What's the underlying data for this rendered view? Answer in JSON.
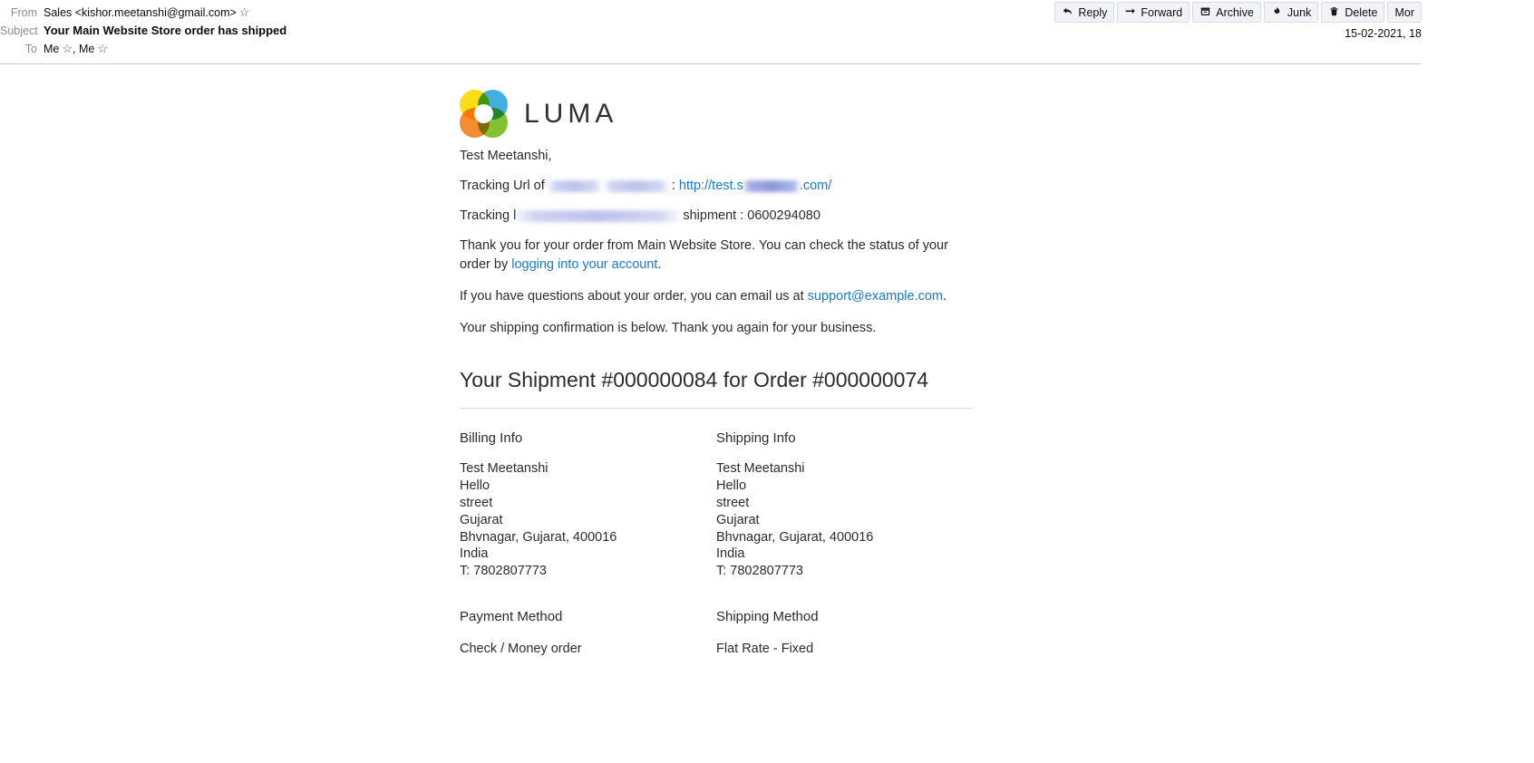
{
  "header": {
    "fields": [
      {
        "label": "From",
        "value": "Sales <kishor.meetanshi@gmail.com>",
        "starred": true
      },
      {
        "label": "Subject",
        "value": "Your Main Website Store order has shipped",
        "starred": false
      },
      {
        "label": "To",
        "value": "Me",
        "value2": "Me",
        "starred": true
      }
    ],
    "to_separator": ", ",
    "date": "15-02-2021, 18"
  },
  "toolbar": {
    "buttons": [
      {
        "label": "Reply",
        "icon": "reply-icon",
        "glyph": "↰"
      },
      {
        "label": "Forward",
        "icon": "forward-icon",
        "glyph": "→"
      },
      {
        "label": "Archive",
        "icon": "archive-icon",
        "glyph": "⤓"
      },
      {
        "label": "Junk",
        "icon": "junk-icon",
        "glyph": "ⓧ"
      },
      {
        "label": "Delete",
        "icon": "trash-icon",
        "glyph": "Ὕ1"
      },
      {
        "label": "Mor",
        "icon": "more-icon",
        "glyph": ""
      }
    ]
  },
  "email": {
    "brand": "LUMA",
    "greeting": "Test Meetanshi,",
    "tracking_url_label": "Tracking Url of",
    "tracking_url_sep": ":",
    "tracking_url_prefix": "http://test.s",
    "tracking_url_suffix": ".com/",
    "tracking_number_label": "Tracking",
    "tracking_number_label_tail": "l",
    "tracking_shipment_label": "shipment :",
    "tracking_number": "0600294080",
    "thankyou_text": "Thank you for your order from Main Website Store. You can check the status of your order by ",
    "thankyou_link": "logging into your account",
    "thankyou_period": ".",
    "questions_text": "If you have questions about your order, you can email us at ",
    "support_email": "support@example.com",
    "support_period": ".",
    "confirmation_text": "Your shipping confirmation is below. Thank you again for your business.",
    "shipment_heading": "Your Shipment #000000084 for Order #000000074",
    "billing": {
      "title": "Billing Info",
      "lines": [
        "Test Meetanshi",
        "Hello",
        "street",
        "Gujarat",
        "Bhvnagar, Gujarat, 400016",
        "India",
        "T: 7802807773"
      ]
    },
    "shipping": {
      "title": "Shipping Info",
      "lines": [
        "Test Meetanshi",
        "Hello",
        "street",
        "Gujarat",
        "Bhvnagar, Gujarat, 400016",
        "India",
        "T: 7802807773"
      ]
    },
    "payment_method": {
      "title": "Payment Method",
      "value": "Check / Money order"
    },
    "shipping_method": {
      "title": "Shipping Method",
      "value": "Flat Rate - Fixed"
    }
  },
  "colors": {
    "link": "#1979c3",
    "label": "#8c8c8c",
    "text": "#2b2b2b",
    "toolbar_bg": "#f1f3f7"
  }
}
